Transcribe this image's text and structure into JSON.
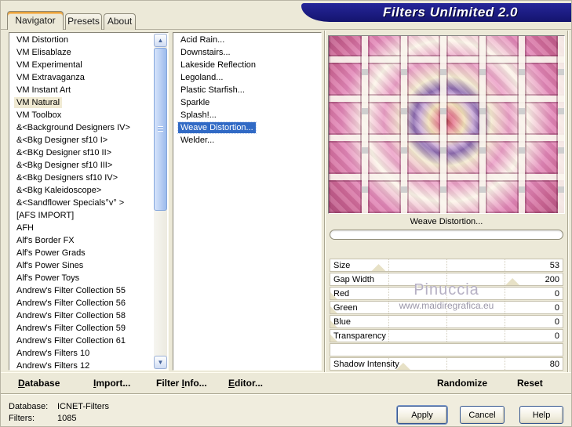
{
  "window": {
    "app_title": "Filters Unlimited 2.0"
  },
  "colors": {
    "dialog_bg": "#ece9d8",
    "banner_navy": "#1b1b86",
    "selection_blue": "#316ac5",
    "active_tab_stripe_orange": "#e8a33d",
    "category_highlight": "#f0ead3"
  },
  "icons": {
    "scroll_up": "▲",
    "scroll_down": "▼"
  },
  "tabs": {
    "items": [
      "Navigator",
      "Presets",
      "About"
    ],
    "active": "Navigator"
  },
  "category_list": {
    "selected": "VM Natural",
    "items": [
      "VM Distortion",
      "VM Elisablaze",
      "VM Experimental",
      "VM Extravaganza",
      "VM Instant Art",
      "VM Natural",
      "VM Toolbox",
      "&<Background Designers IV>",
      "&<Bkg Designer sf10 I>",
      "&<BKg Designer sf10 II>",
      "&<Bkg Designer sf10 III>",
      "&<Bkg Designers sf10 IV>",
      "&<Bkg Kaleidoscope>",
      "&<Sandflower Specials°v° >",
      "[AFS IMPORT]",
      "AFH",
      "Alf's Border FX",
      "Alf's Power Grads",
      "Alf's Power Sines",
      "Alf's Power Toys",
      "Andrew's Filter Collection 55",
      "Andrew's Filter Collection 56",
      "Andrew's Filter Collection 58",
      "Andrew's Filter Collection 59",
      "Andrew's Filter Collection 61",
      "Andrew's Filters 10",
      "Andrew's Filters 12"
    ]
  },
  "filter_list": {
    "selected": "Weave Distortion...",
    "items": [
      "Acid Rain...",
      "Downstairs...",
      "Lakeside Reflection",
      "Legoland...",
      "Plastic Starfish...",
      "Sparkle",
      "Splash!...",
      "Weave Distortion...",
      "Welder..."
    ]
  },
  "preview": {
    "caption": "Weave Distortion...",
    "progress_percent": 0
  },
  "parameters": [
    {
      "label": "Size",
      "value": 53,
      "range_max": 255
    },
    {
      "label": "Gap Width",
      "value": 200,
      "range_max": 255
    },
    {
      "label": "Red",
      "value": 0,
      "range_max": 255
    },
    {
      "label": "Green",
      "value": 0,
      "range_max": 255
    },
    {
      "label": "Blue",
      "value": 0,
      "range_max": 255
    },
    {
      "label": "Transparency",
      "value": 0,
      "range_max": 255
    },
    {
      "label": "",
      "value": null,
      "range_max": 255
    },
    {
      "label": "Shadow Intensity",
      "value": 80,
      "range_max": 255
    }
  ],
  "watermark": {
    "line1": "Pinuccia",
    "line2": "www.maidiregrafica.eu"
  },
  "menu": {
    "items": [
      {
        "pre": "",
        "u": "D",
        "post": "atabase"
      },
      {
        "pre": "",
        "u": "I",
        "post": "mport..."
      },
      {
        "pre": "Filter ",
        "u": "I",
        "post": "nfo..."
      },
      {
        "pre": "",
        "u": "E",
        "post": "ditor..."
      }
    ],
    "right": [
      {
        "label": "Randomize"
      },
      {
        "label": "Reset"
      }
    ]
  },
  "status": {
    "rows": [
      {
        "label": "Database:",
        "value": "ICNET-Filters"
      },
      {
        "label": "Filters:",
        "value": "1085"
      }
    ]
  },
  "buttons": {
    "apply": "Apply",
    "cancel": "Cancel",
    "help": "Help"
  }
}
